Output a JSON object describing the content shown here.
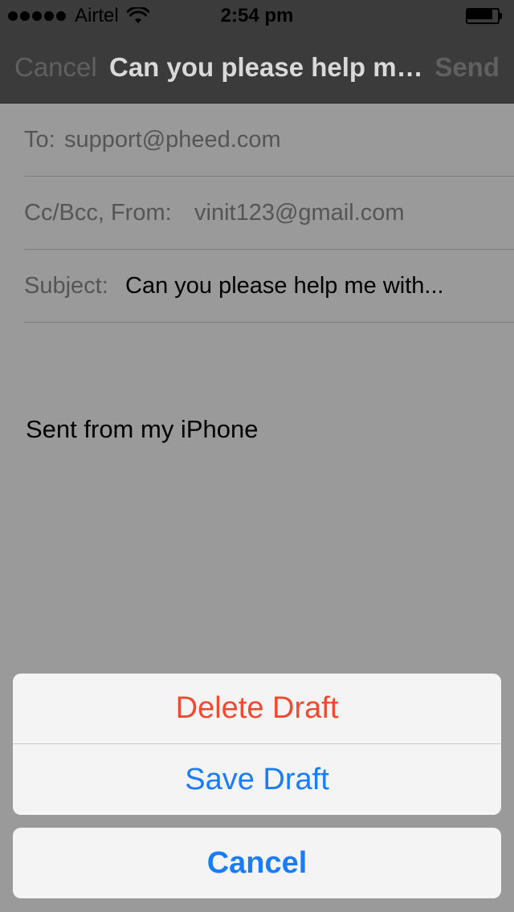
{
  "status_bar": {
    "carrier": "Airtel",
    "time": "2:54 pm",
    "signal_bars": 5,
    "battery_level": 0.9,
    "icons": [
      "signal-dots-icon",
      "wifi-icon",
      "battery-icon"
    ]
  },
  "nav": {
    "cancel_label": "Cancel",
    "title": "Can you please help m…",
    "send_label": "Send"
  },
  "compose": {
    "to_label": "To:",
    "to_value": "support@pheed.com",
    "ccbcc_label": "Cc/Bcc, From:",
    "from_value": "vinit123@gmail.com",
    "subject_label": "Subject:",
    "subject_value": "Can you please help me with...",
    "body_signature": "Sent from my iPhone"
  },
  "action_sheet": {
    "delete_label": "Delete Draft",
    "save_label": "Save Draft",
    "cancel_label": "Cancel",
    "colors": {
      "destructive": "#f04a33",
      "default": "#1a7cf6"
    }
  }
}
